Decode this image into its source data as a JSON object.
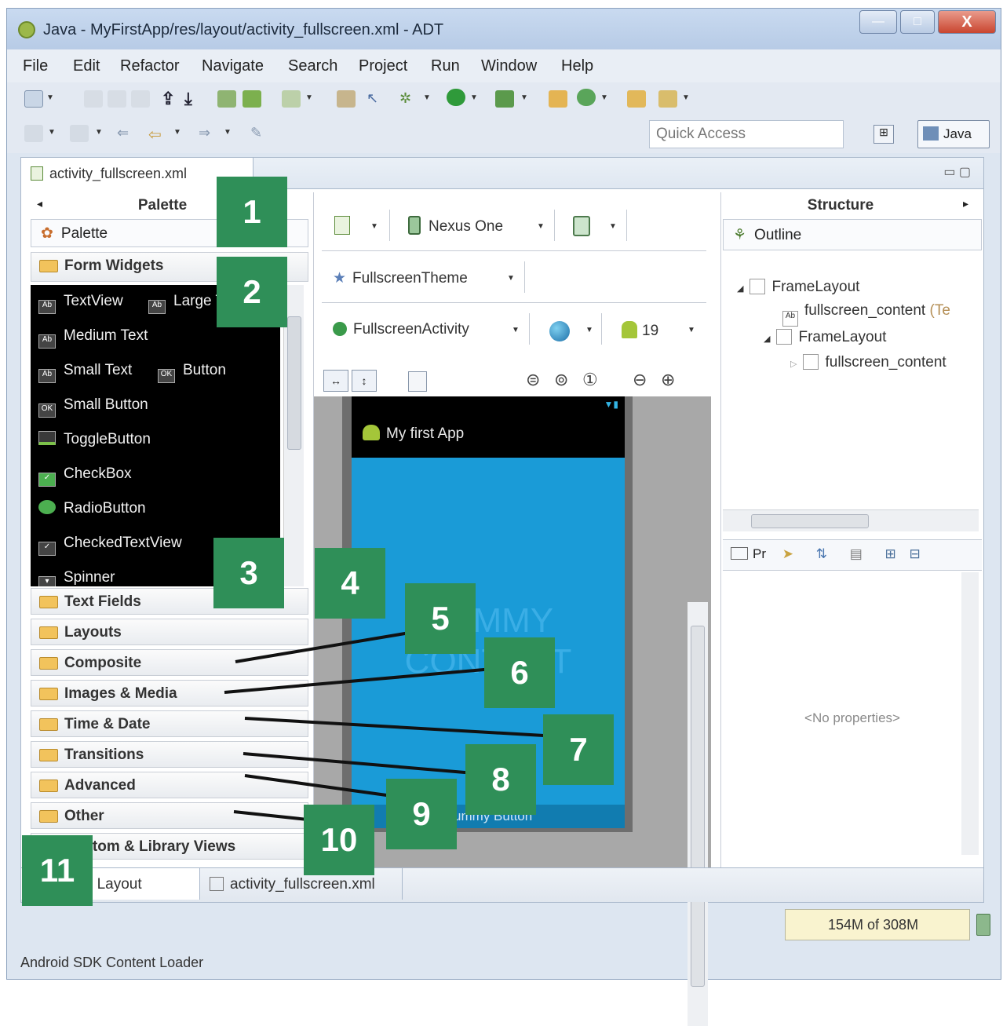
{
  "window": {
    "title": "Java - MyFirstApp/res/layout/activity_fullscreen.xml - ADT",
    "controls": {
      "minimize": "—",
      "maximize": "□",
      "close": "X"
    }
  },
  "menubar": [
    "File",
    "Edit",
    "Refactor",
    "Navigate",
    "Search",
    "Project",
    "Run",
    "Window",
    "Help"
  ],
  "toolbar": {
    "quick_access_placeholder": "Quick Access",
    "perspective_label": "Java"
  },
  "editor": {
    "tab_label": "activity_fullscreen.xml",
    "palette": {
      "title": "Palette",
      "dropdown": "Palette",
      "open_category": "Form Widgets",
      "widgets": [
        "TextView",
        "Large Text",
        "Medium Text",
        "Small Text",
        "Button",
        "Small Button",
        "ToggleButton",
        "CheckBox",
        "RadioButton",
        "CheckedTextView",
        "Spinner"
      ],
      "categories": [
        "Text Fields",
        "Layouts",
        "Composite",
        "Images & Media",
        "Time & Date",
        "Transitions",
        "Advanced",
        "Other",
        "Custom & Library Views"
      ]
    },
    "canvas": {
      "device": "Nexus One",
      "theme": "FullscreenTheme",
      "activity": "FullscreenActivity",
      "api_level": "19",
      "app_title": "My first App",
      "content_text": "DUMMY CONTENT",
      "button_text": "Dummy Button"
    },
    "structure": {
      "title": "Structure",
      "outline_label": "Outline",
      "tree": [
        {
          "label": "FrameLayout"
        },
        {
          "label": "fullscreen_content",
          "hint": "(Te"
        },
        {
          "label": "FrameLayout"
        },
        {
          "label": "fullscreen_content"
        }
      ],
      "properties_tab": "Pr",
      "no_properties": "<No properties>"
    },
    "bottom_tabs": [
      "Graphical Layout",
      "activity_fullscreen.xml"
    ]
  },
  "memory": "154M of 308M",
  "status_text": "Android SDK Content Loader",
  "markers": [
    "1",
    "2",
    "3",
    "4",
    "5",
    "6",
    "7",
    "8",
    "9",
    "10",
    "11"
  ],
  "colors": {
    "marker": "#2f8f58",
    "device_screen": "#1a9bd7",
    "palette_list": "#000000"
  }
}
